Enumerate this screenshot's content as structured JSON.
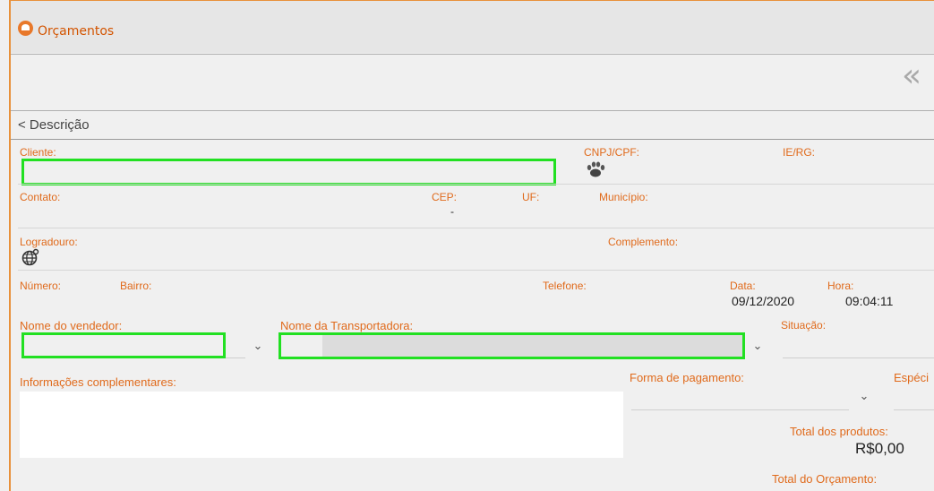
{
  "window": {
    "title": "Orçamentos"
  },
  "toolbar": {
    "collapse_glyph": "«"
  },
  "section": {
    "title": "< Descrição"
  },
  "form": {
    "cliente_label": "Cliente:",
    "cnpj_label": "CNPJ/CPF:",
    "ie_label": "IE/RG:",
    "contato_label": "Contato:",
    "cep_label": "CEP:",
    "cep_value": "-",
    "uf_label": "UF:",
    "municipio_label": "Município:",
    "logradouro_label": "Logradouro:",
    "complemento_label": "Complemento:",
    "numero_label": "Número:",
    "bairro_label": "Bairro:",
    "telefone_label": "Telefone:",
    "data_label": "Data:",
    "data_value": "09/12/2020",
    "hora_label": "Hora:",
    "hora_value": "09:04:11",
    "vendedor_label": "Nome do vendedor:",
    "transportadora_label": "Nome da Transportadora:",
    "situacao_label": "Situação:",
    "info_label": "Informações complementares:",
    "pagamento_label": "Forma de pagamento:",
    "especie_label": "Espéci",
    "total_produtos_label": "Total dos produtos:",
    "total_produtos_value": "R$0,00",
    "total_orcamento_label": "Total do Orçamento:"
  },
  "icons": [
    "app-logo-icon",
    "paw-icon",
    "globe-icon",
    "chevron-down-icon",
    "double-chevron-left-icon"
  ]
}
